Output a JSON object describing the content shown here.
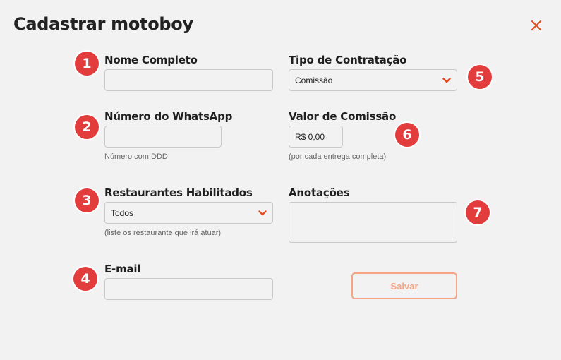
{
  "dialog": {
    "title": "Cadastrar motoboy",
    "close_icon": "close-icon"
  },
  "form": {
    "nome": {
      "label": "Nome Completo",
      "value": ""
    },
    "whatsapp": {
      "label": "Número do WhatsApp",
      "value": "",
      "hint": "Número com DDD"
    },
    "restaurantes": {
      "label": "Restaurantes Habilitados",
      "selected": "Todos",
      "hint": "(liste os restaurante que irá atuar)"
    },
    "email": {
      "label": "E-mail",
      "value": ""
    },
    "tipo": {
      "label": "Tipo de Contratação",
      "selected": "Comissão"
    },
    "comissao": {
      "label": "Valor de Comissão",
      "value": "R$ 0,00",
      "hint": "(por cada entrega completa)"
    },
    "anotacoes": {
      "label": "Anotações",
      "value": ""
    },
    "save_label": "Salvar"
  },
  "markers": [
    "1",
    "2",
    "3",
    "4",
    "5",
    "6",
    "7"
  ],
  "colors": {
    "accent": "#e8491d",
    "marker": "#e23c3c",
    "save_border": "#f4a482",
    "background": "#f2f2f2"
  }
}
